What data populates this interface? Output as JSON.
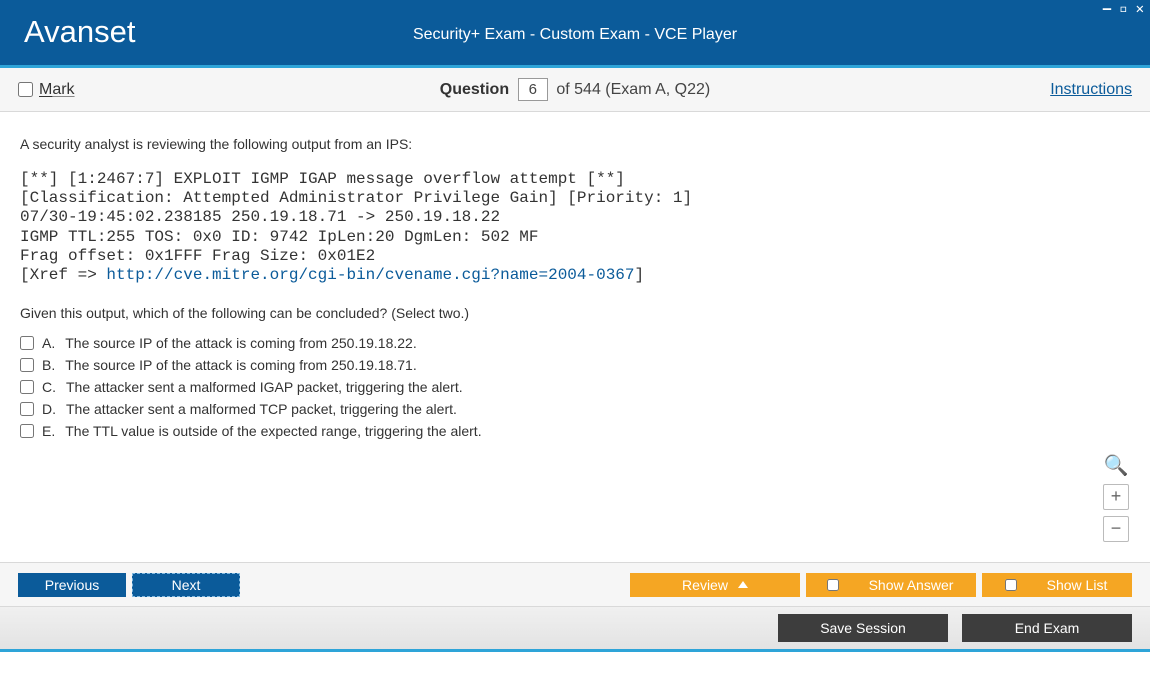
{
  "window": {
    "minimize": "—",
    "maximize": "▫",
    "close": "✕"
  },
  "header": {
    "brand": "Avanset",
    "title": "Security+ Exam - Custom Exam - VCE Player"
  },
  "subbar": {
    "mark_label": "Mark",
    "question_label": "Question",
    "question_number": "6",
    "question_suffix": "of 544 (Exam A, Q22)",
    "instructions": "Instructions"
  },
  "question": {
    "intro": "A security analyst is reviewing the following output from an IPS:",
    "mono_lines": [
      "[**] [1:2467:7] EXPLOIT IGMP IGAP message overflow attempt [**]",
      "[Classification: Attempted Administrator Privilege Gain] [Priority: 1]",
      "07/30-19:45:02.238185 250.19.18.71 -> 250.19.18.22",
      "IGMP TTL:255 TOS: 0x0 ID: 9742 IpLen:20 DgmLen: 502 MF",
      "Frag offset: 0x1FFF Frag Size: 0x01E2"
    ],
    "xref_prefix": "[Xref => ",
    "xref_link": "http://cve.mitre.org/cgi-bin/cvename.cgi?name=2004-0367",
    "xref_suffix": "]",
    "prompt": "Given this output, which of the following can be concluded? (Select two.)",
    "options": [
      {
        "letter": "A.",
        "text": "The source IP of the attack is coming from 250.19.18.22."
      },
      {
        "letter": "B.",
        "text": "The source IP of the attack is coming from 250.19.18.71."
      },
      {
        "letter": "C.",
        "text": "The attacker sent a malformed IGAP packet, triggering the alert."
      },
      {
        "letter": "D.",
        "text": "The attacker sent a malformed TCP packet, triggering the alert."
      },
      {
        "letter": "E.",
        "text": "The TTL value is outside of the expected range, triggering the alert."
      }
    ]
  },
  "footer": {
    "previous": "Previous",
    "next": "Next",
    "review": "Review",
    "show_answer": "Show Answer",
    "show_list": "Show List"
  },
  "footer2": {
    "save_session": "Save Session",
    "end_exam": "End Exam"
  },
  "zoom": {
    "plus": "+",
    "minus": "−"
  }
}
